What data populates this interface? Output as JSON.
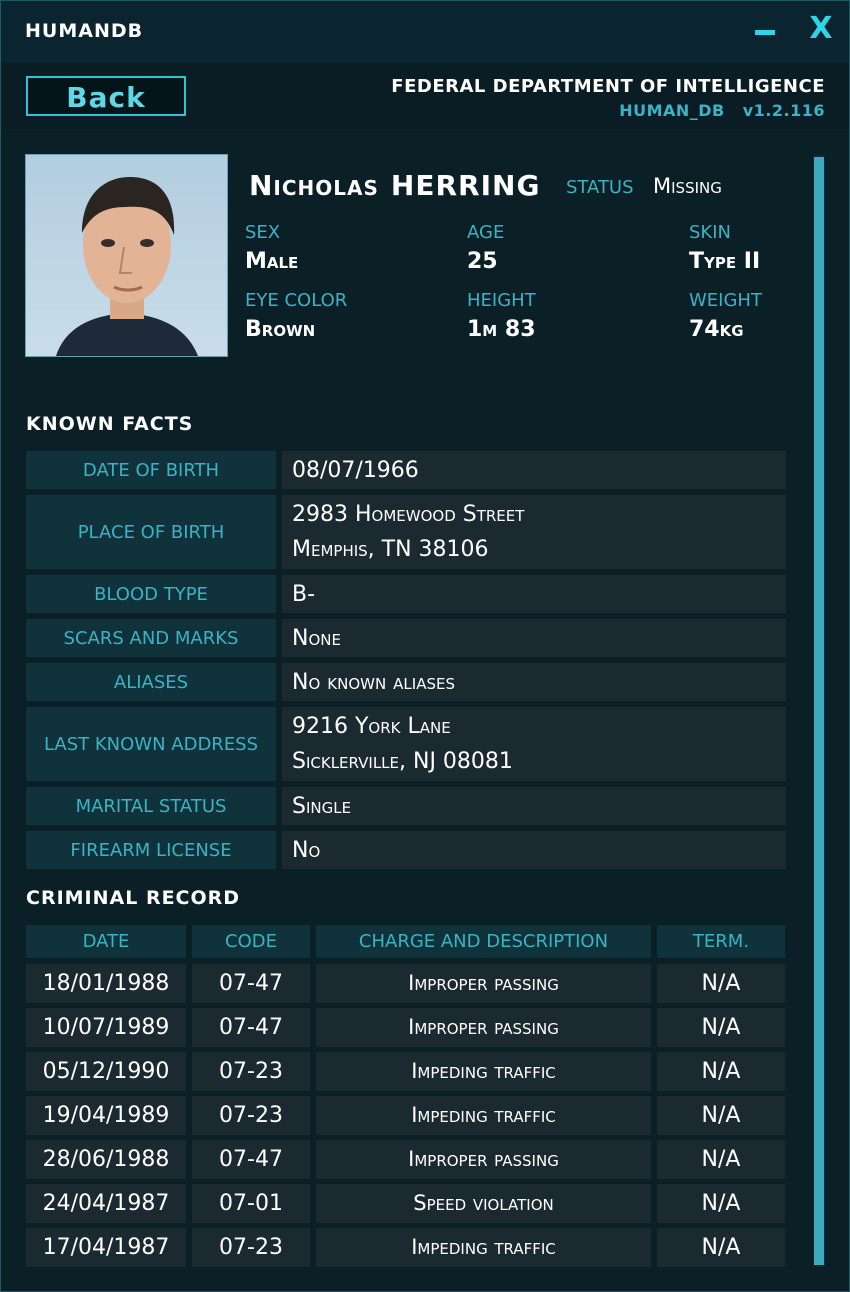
{
  "window": {
    "title": "HUMANDB",
    "minimize_label": "–",
    "close_label": "X"
  },
  "header": {
    "back_label": "Back",
    "agency": "FEDERAL DEPARTMENT OF INTELLIGENCE",
    "db_name": "HUMAN_DB",
    "version": "v1.2.116"
  },
  "profile": {
    "first_name": "Nicholas",
    "last_name": "HERRING",
    "status_label": "STATUS",
    "status_value": "Missing",
    "attributes": [
      {
        "label": "SEX",
        "value": "Male"
      },
      {
        "label": "AGE",
        "value": "25"
      },
      {
        "label": "SKIN",
        "value": "Type II"
      },
      {
        "label": "EYE COLOR",
        "value": "Brown"
      },
      {
        "label": "HEIGHT",
        "value": "1m 83"
      },
      {
        "label": "WEIGHT",
        "value": "74kg"
      }
    ]
  },
  "known_facts": {
    "title": "KNOWN  FACTS",
    "rows": [
      {
        "label": "DATE OF BIRTH",
        "lines": [
          "08/07/1966"
        ]
      },
      {
        "label": "PLACE OF BIRTH",
        "lines": [
          "2983 Homewood Street",
          "Memphis, TN 38106"
        ]
      },
      {
        "label": "BLOOD TYPE",
        "lines": [
          "B-"
        ]
      },
      {
        "label": "SCARS AND MARKS",
        "lines": [
          "None"
        ]
      },
      {
        "label": "ALIASES",
        "lines": [
          "No known aliases"
        ]
      },
      {
        "label": "LAST KNOWN ADDRESS",
        "lines": [
          "9216 York Lane",
          "Sicklerville, NJ 08081"
        ]
      },
      {
        "label": "MARITAL STATUS",
        "lines": [
          "Single"
        ]
      },
      {
        "label": "FIREARM LICENSE",
        "lines": [
          "No"
        ]
      }
    ]
  },
  "criminal_record": {
    "title": "CRIMINAL  RECORD",
    "columns": [
      "DATE",
      "CODE",
      "CHARGE AND DESCRIPTION",
      "TERM."
    ],
    "rows": [
      [
        "18/01/1988",
        "07-47",
        "Improper passing",
        "N/A"
      ],
      [
        "10/07/1989",
        "07-47",
        "Improper passing",
        "N/A"
      ],
      [
        "05/12/1990",
        "07-23",
        "Impeding traffic",
        "N/A"
      ],
      [
        "19/04/1989",
        "07-23",
        "Impeding traffic",
        "N/A"
      ],
      [
        "28/06/1988",
        "07-47",
        "Improper passing",
        "N/A"
      ],
      [
        "24/04/1987",
        "07-01",
        "Speed violation",
        "N/A"
      ],
      [
        "17/04/1987",
        "07-23",
        "Impeding traffic",
        "N/A"
      ]
    ]
  },
  "colors": {
    "accent": "#2fd4e6",
    "label": "#3ab3c4",
    "background": "#0b1f27"
  }
}
